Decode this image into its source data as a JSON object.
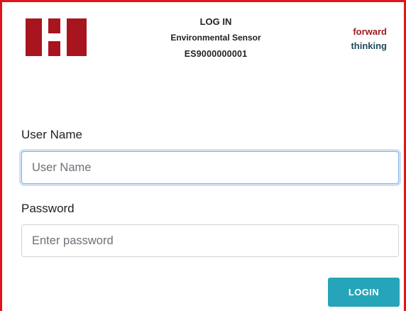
{
  "header": {
    "title": "LOG IN",
    "device_name": "Environmental Sensor",
    "device_id": "ES9000000001"
  },
  "brand": {
    "line1": "forward",
    "line2": "thinking",
    "logo_color": "#a8151e"
  },
  "form": {
    "username_label": "User Name",
    "username_placeholder": "User Name",
    "username_value": "",
    "password_label": "Password",
    "password_placeholder": "Enter password",
    "password_value": "",
    "submit_label": "LOGIN"
  },
  "colors": {
    "frame_border": "#e1141b",
    "button_bg": "#26a4b9",
    "brand_red": "#9e1b22",
    "brand_teal": "#1f4a5c",
    "focus_ring": "#86b7e8"
  }
}
